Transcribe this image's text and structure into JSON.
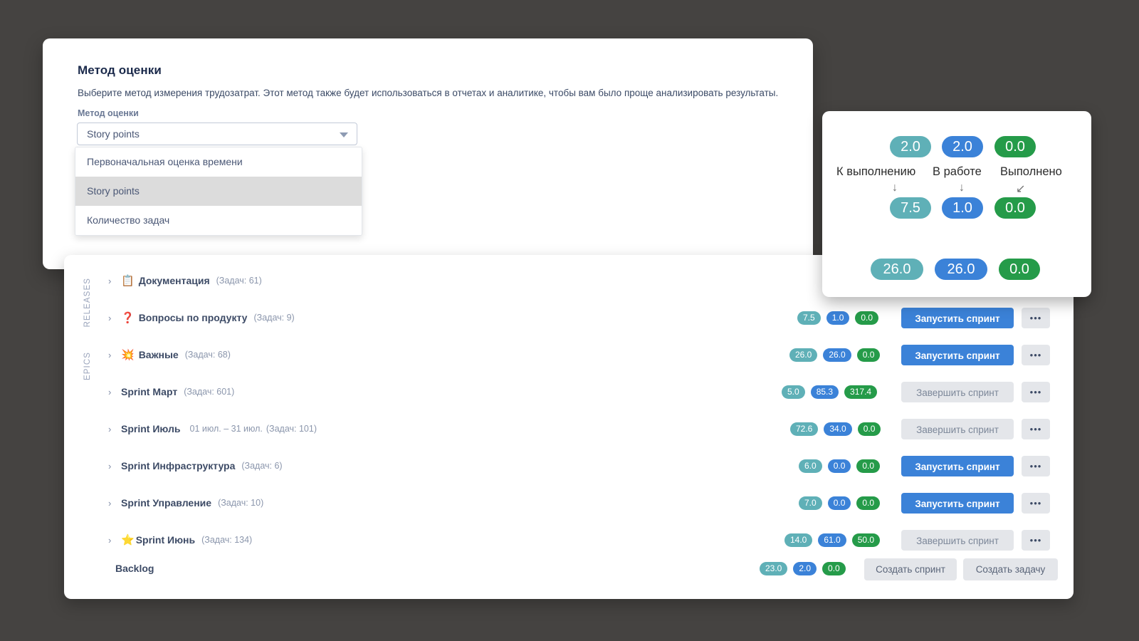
{
  "theme": {
    "background": "#454341",
    "badge_todo": "#5fb0b7",
    "badge_progress": "#3b82d8",
    "badge_done": "#259b49",
    "primary_button": "#3b82d8",
    "muted_button": "#e4e6ea"
  },
  "settings": {
    "title": "Метод оценки",
    "description": "Выберите метод измерения трудозатрат. Этот метод также будет использоваться в отчетах и аналитике, чтобы вам было проще анализировать результаты.",
    "field_label": "Метод оценки",
    "select_value": "Story points",
    "caret_icon": "chevron-down-icon",
    "options": [
      {
        "label": "Первоначальная оценка времени",
        "selected": false
      },
      {
        "label": "Story points",
        "selected": true
      },
      {
        "label": "Количество задач",
        "selected": false
      }
    ]
  },
  "backlog": {
    "rails": {
      "releases": "RELEASES",
      "epics": "EPICS"
    },
    "backlog_label": "Backlog",
    "footer_buttons": [
      {
        "label": "Создать спринт"
      },
      {
        "label": "Создать задачу"
      }
    ],
    "footer_badges": {
      "todo": "23.0",
      "progress": "2.0",
      "done": "0.0"
    },
    "rows": [
      {
        "chevron": "›",
        "emoji": "📋",
        "emoji_name": "clipboard-icon",
        "name": "Документация",
        "meta": "(Задач: 61)",
        "dates": "",
        "badges": {
          "todo": "2.0",
          "progress": "",
          "done": ""
        },
        "action": "",
        "action_state": "",
        "dots": "•••"
      },
      {
        "chevron": "›",
        "emoji": "❓",
        "emoji_name": "question-mark-icon",
        "name": "Вопросы по продукту",
        "meta": "(Задач: 9)",
        "dates": "",
        "badges": {
          "todo": "7.5",
          "progress": "1.0",
          "done": "0.0"
        },
        "action": "Запустить спринт",
        "action_state": "primary",
        "dots": "•••"
      },
      {
        "chevron": "›",
        "emoji": "💥",
        "emoji_name": "collision-icon",
        "name": "Важные",
        "meta": "(Задач: 68)",
        "dates": "",
        "badges": {
          "todo": "26.0",
          "progress": "26.0",
          "done": "0.0"
        },
        "action": "Запустить спринт",
        "action_state": "primary",
        "dots": "•••"
      },
      {
        "chevron": "›",
        "emoji": "",
        "emoji_name": "",
        "name": "Sprint Март",
        "meta": "(Задач: 601)",
        "dates": "",
        "badges": {
          "todo": "5.0",
          "progress": "85.3",
          "done": "317.4"
        },
        "action": "Завершить спринт",
        "action_state": "disabled",
        "dots": "•••"
      },
      {
        "chevron": "›",
        "emoji": "",
        "emoji_name": "",
        "name": "Sprint Июль",
        "meta": "(Задач: 101)",
        "dates": "01 июл. – 31 июл.",
        "badges": {
          "todo": "72.6",
          "progress": "34.0",
          "done": "0.0"
        },
        "action": "Завершить спринт",
        "action_state": "disabled",
        "dots": "•••"
      },
      {
        "chevron": "›",
        "emoji": "",
        "emoji_name": "",
        "name": "Sprint Инфраструктура",
        "meta": "(Задач: 6)",
        "dates": "",
        "badges": {
          "todo": "6.0",
          "progress": "0.0",
          "done": "0.0"
        },
        "action": "Запустить спринт",
        "action_state": "primary",
        "dots": "•••"
      },
      {
        "chevron": "›",
        "emoji": "",
        "emoji_name": "",
        "name": "Sprint Управление",
        "meta": "(Задач: 10)",
        "dates": "",
        "badges": {
          "todo": "7.0",
          "progress": "0.0",
          "done": "0.0"
        },
        "action": "Запустить спринт",
        "action_state": "primary",
        "dots": "•••"
      },
      {
        "chevron": "›",
        "emoji": "⭐",
        "emoji_name": "star-icon",
        "name": "Sprint Июнь",
        "meta": "(Задач: 134)",
        "dates": "",
        "badges": {
          "todo": "14.0",
          "progress": "61.0",
          "done": "50.0"
        },
        "action": "Завершить спринт",
        "action_state": "disabled",
        "dots": "•••"
      }
    ]
  },
  "magnifier": {
    "columns": [
      {
        "label": "К выполнению",
        "arrow": "↓"
      },
      {
        "label": "В работе",
        "arrow": "↓"
      },
      {
        "label": "Выполнено",
        "arrow": "↙"
      }
    ],
    "top_row": {
      "todo": "2.0",
      "progress": "2.0",
      "done": "0.0"
    },
    "middle_row": {
      "todo": "7.5",
      "progress": "1.0",
      "done": "0.0"
    },
    "bottom_row": {
      "todo": "26.0",
      "progress": "26.0",
      "done": "0.0"
    }
  }
}
